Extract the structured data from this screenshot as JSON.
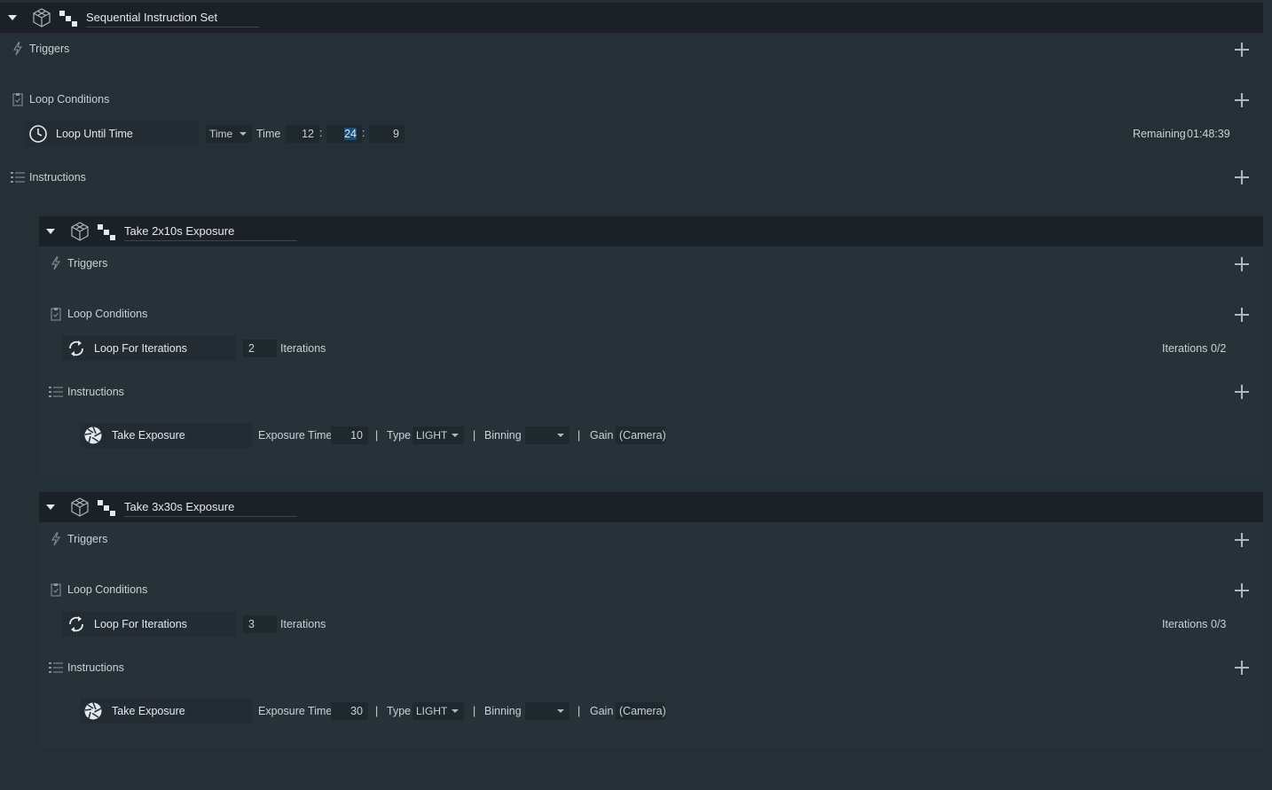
{
  "root": {
    "title": "Sequential Instruction Set",
    "triggers_label": "Triggers",
    "loop_conditions_label": "Loop Conditions",
    "instructions_label": "Instructions",
    "loop_condition": {
      "name": "Loop Until Time",
      "mode": "Time",
      "time_label": "Time",
      "hours": "12",
      "minutes": "24",
      "seconds": "9",
      "colon": ":",
      "remaining_label": "Remaining",
      "remaining_value": "01:48:39"
    }
  },
  "blocks": [
    {
      "title": "Take 2x10s Exposure",
      "triggers_label": "Triggers",
      "loop_conditions_label": "Loop Conditions",
      "instructions_label": "Instructions",
      "loop": {
        "name": "Loop For Iterations",
        "iterations": "2",
        "iterations_label": "Iterations",
        "progress_label": "Iterations",
        "progress": "0/2"
      },
      "instruction": {
        "name": "Take Exposure",
        "exposure_label": "Exposure Time",
        "exposure": "10",
        "sep": "|",
        "type_label": "Type",
        "type": "LIGHT",
        "binning_label": "Binning",
        "binning": "",
        "gain_label": "Gain",
        "gain": "(Camera)"
      }
    },
    {
      "title": "Take 3x30s Exposure",
      "triggers_label": "Triggers",
      "loop_conditions_label": "Loop Conditions",
      "instructions_label": "Instructions",
      "loop": {
        "name": "Loop For Iterations",
        "iterations": "3",
        "iterations_label": "Iterations",
        "progress_label": "Iterations",
        "progress": "0/3"
      },
      "instruction": {
        "name": "Take Exposure",
        "exposure_label": "Exposure Time",
        "exposure": "30",
        "sep": "|",
        "type_label": "Type",
        "type": "LIGHT",
        "binning_label": "Binning",
        "binning": "",
        "gain_label": "Gain",
        "gain": "(Camera)"
      }
    }
  ],
  "colors": {
    "background": "#252f36",
    "header": "#1b2126",
    "field": "#1f282d",
    "highlight": "#1f4e7a"
  },
  "icons": [
    "collapse-arrow-icon",
    "cube-icon",
    "sequence-icon",
    "lightning-icon",
    "clipboard-icon",
    "list-icon",
    "clock-icon",
    "loop-icon",
    "shutter-icon",
    "plus-icon"
  ]
}
